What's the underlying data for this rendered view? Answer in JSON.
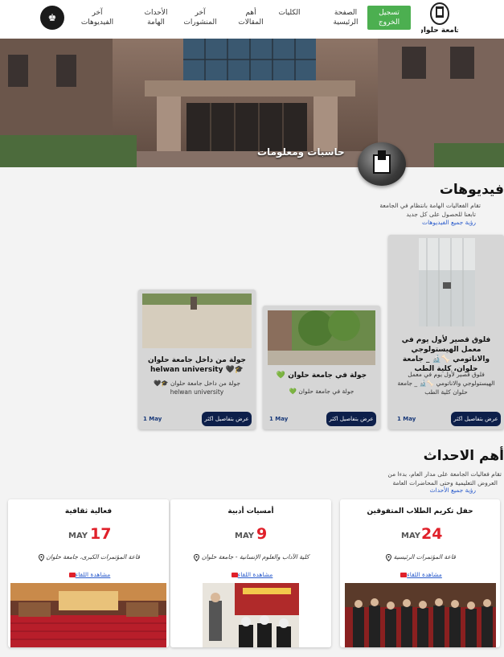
{
  "nav": {
    "logout": "تسجيل الخروج",
    "items": [
      {
        "label": "الصفحة الرئيسية"
      },
      {
        "label": "الكليات"
      },
      {
        "label": "أهم المقالات"
      },
      {
        "label": "آخر المنشورات"
      },
      {
        "label": "الأحداث الهامة"
      },
      {
        "label": "آخر الفيديوهات"
      }
    ],
    "logo_text": "جامعة حلوان"
  },
  "hero": {
    "title": "حاسبات ومعلومات"
  },
  "videos": {
    "title": "فيديوهات",
    "desc_line1": "تقام الفعاليات الهامة بانتظام في الجامعة",
    "desc_line2": "تابعنا للحصول على كل جديد",
    "link": "رؤية جميع الفيديوهات",
    "cards": [
      {
        "title": "فلوق قصير لأول يوم في معمل الهيستولوجي والاناتومي 🦴🔬 _ جامعة حلوان، كلية الطب",
        "desc": "فلوق قصير لأول يوم في معمل الهيستولوجي والاناتومي 🦴🔬 _ جامعة حلوان كلية الطب",
        "date": "1 May",
        "button": "عرض بتفاصيل اكثر"
      },
      {
        "title": "جولة في جامعة حلوان 💚",
        "desc": "جولة في جامعة حلوان 💚",
        "date": "1 May",
        "button": "عرض بتفاصيل اكثر"
      },
      {
        "title": "جولة من داخل جامعة حلوان 🎓🖤 helwan university",
        "desc": "جولة من داخل جامعة حلوان 🎓🖤 helwan university",
        "date": "1 May",
        "button": "عرض بتفاصيل اكثر"
      }
    ]
  },
  "events": {
    "title": "أهم الاحداث",
    "desc_line1": "تقام فعاليات الجامعة على مدار العام، بدءا من",
    "desc_line2": "العروض التعليمية وحتى المحاضرات العامة",
    "link": "رؤية جميع الأحداث",
    "cards": [
      {
        "title": "حفل تكريم الطلاب المتفوقين",
        "month": "MAY",
        "day": "24",
        "place": "قاعة المؤتمرات الرئيسية",
        "meet": "مشاهدة اللقاء"
      },
      {
        "title": "أمسيات أدبية",
        "month": "MAY",
        "day": "9",
        "place": "كلية الآداب والعلوم الإنسانية - جامعة حلوان",
        "meet": "مشاهدة اللقاء"
      },
      {
        "title": "فعالية ثقافية",
        "month": "MAY",
        "day": "17",
        "place": "قاعة المؤتمرات الكبرى، جامعة حلوان",
        "meet": "مشاهدة اللقاء"
      }
    ]
  },
  "colors": {
    "accent_green": "#4caf50",
    "button_navy": "#0d1f4a",
    "date_red": "#e0202a",
    "link_blue": "#2b5ccc"
  }
}
